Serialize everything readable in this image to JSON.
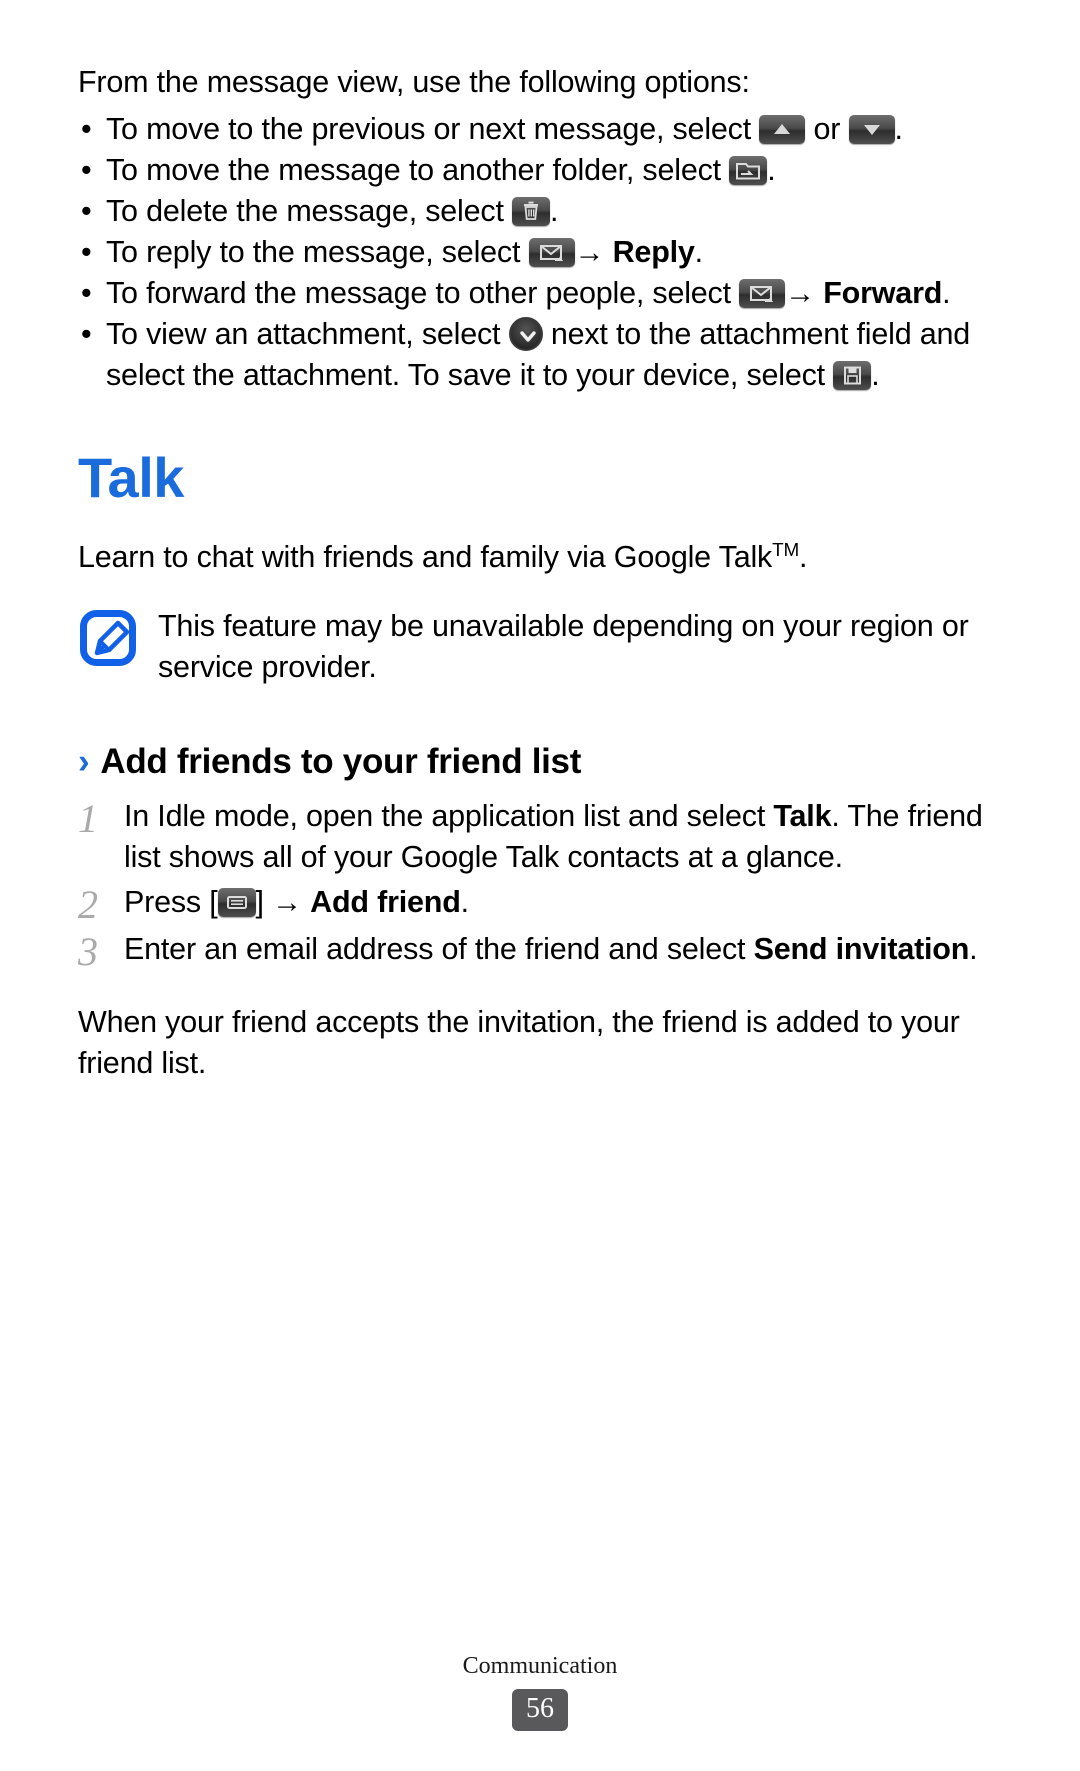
{
  "document": {
    "intro_paragraph": "From the message view, use the following options:",
    "bullets": [
      {
        "id": "move-prev-next",
        "text_before": "To move to the previous or next message, select ",
        "icon1": "arrow-up-key-icon",
        "text_middle": " or ",
        "icon2": "arrow-down-key-icon",
        "text_after": "."
      },
      {
        "id": "move-folder",
        "text_before": "To move the message to another folder, select ",
        "icon1": "move-to-folder-icon",
        "text_after": "."
      },
      {
        "id": "delete-message",
        "text_before": "To delete the message, select ",
        "icon1": "trash-icon",
        "text_after": "."
      },
      {
        "id": "reply-message",
        "text_before": "To reply to the message, select ",
        "icon1": "reply-envelope-icon",
        "arrow": "→",
        "bold_label": "Reply",
        "text_after": "."
      },
      {
        "id": "forward-message",
        "text_before": "To forward the message to other people, select ",
        "icon1": "forward-envelope-icon",
        "arrow": "→",
        "bold_label": "Forward",
        "text_after": "."
      },
      {
        "id": "view-attachment",
        "text_before": "To view an attachment, select ",
        "icon1": "chevron-down-circle-icon",
        "text_middle": " next to the attachment field and select the attachment. To save it to your device, select ",
        "icon2": "save-disk-icon",
        "text_after": "."
      }
    ],
    "section": {
      "title": "Talk",
      "title_color": "#1a6bdc",
      "lead": "Learn to chat with friends and family via Google Talk",
      "lead_superscript": "TM",
      "lead_tail": ".",
      "note": {
        "icon": "note-pencil-icon",
        "icon_color": "#1061e8",
        "text": "This feature may be unavailable depending on your region or service provider."
      },
      "subheading": {
        "chevron": "›",
        "text": "Add friends to your friend list"
      },
      "steps": [
        {
          "number": "1",
          "text_before": "In Idle mode, open the application list and select ",
          "bold_label": "Talk",
          "text_after": ". The friend list shows all of your Google Talk contacts at a glance."
        },
        {
          "number": "2",
          "text_before": "Press [",
          "icon1": "menu-key-icon",
          "text_middle": "] ",
          "arrow": "→",
          "bold_label": "Add friend",
          "text_after": "."
        },
        {
          "number": "3",
          "text_before": "Enter an email address of the friend and select ",
          "bold_label": "Send invitation",
          "text_after": "."
        }
      ],
      "closing_paragraph": "When your friend accepts the invitation, the friend is added to your friend list."
    },
    "footer": {
      "chapter": "Communication",
      "page_number": "56",
      "badge_color": "#59595b"
    }
  }
}
